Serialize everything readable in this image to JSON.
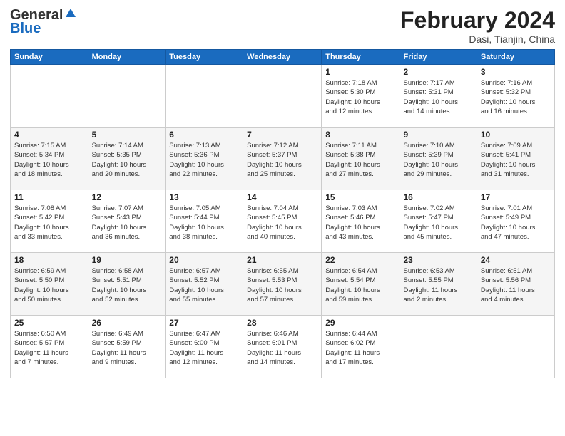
{
  "header": {
    "logo_general": "General",
    "logo_blue": "Blue",
    "main_title": "February 2024",
    "sub_title": "Dasi, Tianjin, China"
  },
  "days_of_week": [
    "Sunday",
    "Monday",
    "Tuesday",
    "Wednesday",
    "Thursday",
    "Friday",
    "Saturday"
  ],
  "weeks": [
    [
      {
        "day": "",
        "info": ""
      },
      {
        "day": "",
        "info": ""
      },
      {
        "day": "",
        "info": ""
      },
      {
        "day": "",
        "info": ""
      },
      {
        "day": "1",
        "info": "Sunrise: 7:18 AM\nSunset: 5:30 PM\nDaylight: 10 hours\nand 12 minutes."
      },
      {
        "day": "2",
        "info": "Sunrise: 7:17 AM\nSunset: 5:31 PM\nDaylight: 10 hours\nand 14 minutes."
      },
      {
        "day": "3",
        "info": "Sunrise: 7:16 AM\nSunset: 5:32 PM\nDaylight: 10 hours\nand 16 minutes."
      }
    ],
    [
      {
        "day": "4",
        "info": "Sunrise: 7:15 AM\nSunset: 5:34 PM\nDaylight: 10 hours\nand 18 minutes."
      },
      {
        "day": "5",
        "info": "Sunrise: 7:14 AM\nSunset: 5:35 PM\nDaylight: 10 hours\nand 20 minutes."
      },
      {
        "day": "6",
        "info": "Sunrise: 7:13 AM\nSunset: 5:36 PM\nDaylight: 10 hours\nand 22 minutes."
      },
      {
        "day": "7",
        "info": "Sunrise: 7:12 AM\nSunset: 5:37 PM\nDaylight: 10 hours\nand 25 minutes."
      },
      {
        "day": "8",
        "info": "Sunrise: 7:11 AM\nSunset: 5:38 PM\nDaylight: 10 hours\nand 27 minutes."
      },
      {
        "day": "9",
        "info": "Sunrise: 7:10 AM\nSunset: 5:39 PM\nDaylight: 10 hours\nand 29 minutes."
      },
      {
        "day": "10",
        "info": "Sunrise: 7:09 AM\nSunset: 5:41 PM\nDaylight: 10 hours\nand 31 minutes."
      }
    ],
    [
      {
        "day": "11",
        "info": "Sunrise: 7:08 AM\nSunset: 5:42 PM\nDaylight: 10 hours\nand 33 minutes."
      },
      {
        "day": "12",
        "info": "Sunrise: 7:07 AM\nSunset: 5:43 PM\nDaylight: 10 hours\nand 36 minutes."
      },
      {
        "day": "13",
        "info": "Sunrise: 7:05 AM\nSunset: 5:44 PM\nDaylight: 10 hours\nand 38 minutes."
      },
      {
        "day": "14",
        "info": "Sunrise: 7:04 AM\nSunset: 5:45 PM\nDaylight: 10 hours\nand 40 minutes."
      },
      {
        "day": "15",
        "info": "Sunrise: 7:03 AM\nSunset: 5:46 PM\nDaylight: 10 hours\nand 43 minutes."
      },
      {
        "day": "16",
        "info": "Sunrise: 7:02 AM\nSunset: 5:47 PM\nDaylight: 10 hours\nand 45 minutes."
      },
      {
        "day": "17",
        "info": "Sunrise: 7:01 AM\nSunset: 5:49 PM\nDaylight: 10 hours\nand 47 minutes."
      }
    ],
    [
      {
        "day": "18",
        "info": "Sunrise: 6:59 AM\nSunset: 5:50 PM\nDaylight: 10 hours\nand 50 minutes."
      },
      {
        "day": "19",
        "info": "Sunrise: 6:58 AM\nSunset: 5:51 PM\nDaylight: 10 hours\nand 52 minutes."
      },
      {
        "day": "20",
        "info": "Sunrise: 6:57 AM\nSunset: 5:52 PM\nDaylight: 10 hours\nand 55 minutes."
      },
      {
        "day": "21",
        "info": "Sunrise: 6:55 AM\nSunset: 5:53 PM\nDaylight: 10 hours\nand 57 minutes."
      },
      {
        "day": "22",
        "info": "Sunrise: 6:54 AM\nSunset: 5:54 PM\nDaylight: 10 hours\nand 59 minutes."
      },
      {
        "day": "23",
        "info": "Sunrise: 6:53 AM\nSunset: 5:55 PM\nDaylight: 11 hours\nand 2 minutes."
      },
      {
        "day": "24",
        "info": "Sunrise: 6:51 AM\nSunset: 5:56 PM\nDaylight: 11 hours\nand 4 minutes."
      }
    ],
    [
      {
        "day": "25",
        "info": "Sunrise: 6:50 AM\nSunset: 5:57 PM\nDaylight: 11 hours\nand 7 minutes."
      },
      {
        "day": "26",
        "info": "Sunrise: 6:49 AM\nSunset: 5:59 PM\nDaylight: 11 hours\nand 9 minutes."
      },
      {
        "day": "27",
        "info": "Sunrise: 6:47 AM\nSunset: 6:00 PM\nDaylight: 11 hours\nand 12 minutes."
      },
      {
        "day": "28",
        "info": "Sunrise: 6:46 AM\nSunset: 6:01 PM\nDaylight: 11 hours\nand 14 minutes."
      },
      {
        "day": "29",
        "info": "Sunrise: 6:44 AM\nSunset: 6:02 PM\nDaylight: 11 hours\nand 17 minutes."
      },
      {
        "day": "",
        "info": ""
      },
      {
        "day": "",
        "info": ""
      }
    ]
  ]
}
